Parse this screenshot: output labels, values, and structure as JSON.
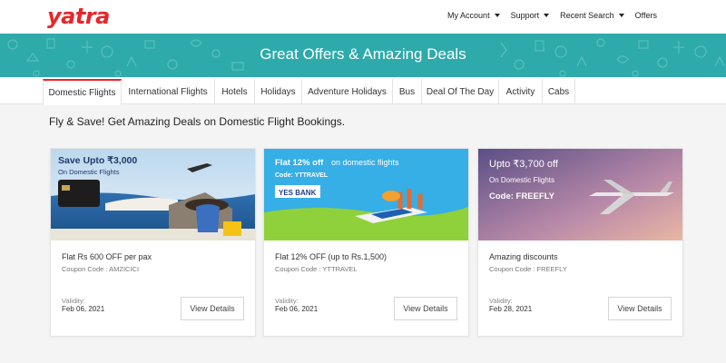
{
  "header": {
    "logo": "yatra",
    "nav": [
      {
        "label": "My Account",
        "dropdown": true
      },
      {
        "label": "Support",
        "dropdown": true
      },
      {
        "label": "Recent Search",
        "dropdown": true
      },
      {
        "label": "Offers",
        "dropdown": false
      }
    ]
  },
  "banner": {
    "title": "Great Offers & Amazing Deals"
  },
  "tabs": [
    {
      "label": "Domestic Flights",
      "active": true
    },
    {
      "label": "International Flights"
    },
    {
      "label": "Hotels"
    },
    {
      "label": "Holidays"
    },
    {
      "label": "Adventure Holidays"
    },
    {
      "label": "Bus"
    },
    {
      "label": "Deal Of The Day"
    },
    {
      "label": "Activity"
    },
    {
      "label": "Cabs"
    }
  ],
  "subtitle": "Fly & Save! Get Amazing Deals on Domestic Flight Bookings.",
  "cards": [
    {
      "img": {
        "line1": "Save Upto ₹3,000",
        "line2": "On Domestic Flights"
      },
      "title": "Flat Rs 600 OFF per pax",
      "code": "Coupon Code : AMZICICI",
      "validity_label": "Validity:",
      "validity": "Feb 06, 2021",
      "button": "View Details"
    },
    {
      "img": {
        "line1a": "Flat 12% off",
        "line1b": " on domestic flights",
        "line2": "Code: YTTRAVEL",
        "bank": "YES BANK"
      },
      "title": "Flat 12% OFF (up to Rs.1,500)",
      "code": "Coupon Code : YTTRAVEL",
      "validity_label": "Validity:",
      "validity": "Feb 06, 2021",
      "button": "View Details"
    },
    {
      "img": {
        "line1": "Upto ₹3,700 off",
        "line2": "On Domestic Flights",
        "line3": "Code: FREEFLY"
      },
      "title": "Amazing discounts",
      "code": "Coupon Code : FREEFLY",
      "validity_label": "Validity:",
      "validity": "Feb 28, 2021",
      "button": "View Details"
    }
  ],
  "colors": {
    "brand": "#e8262b",
    "banner": "#2eaaaa"
  }
}
